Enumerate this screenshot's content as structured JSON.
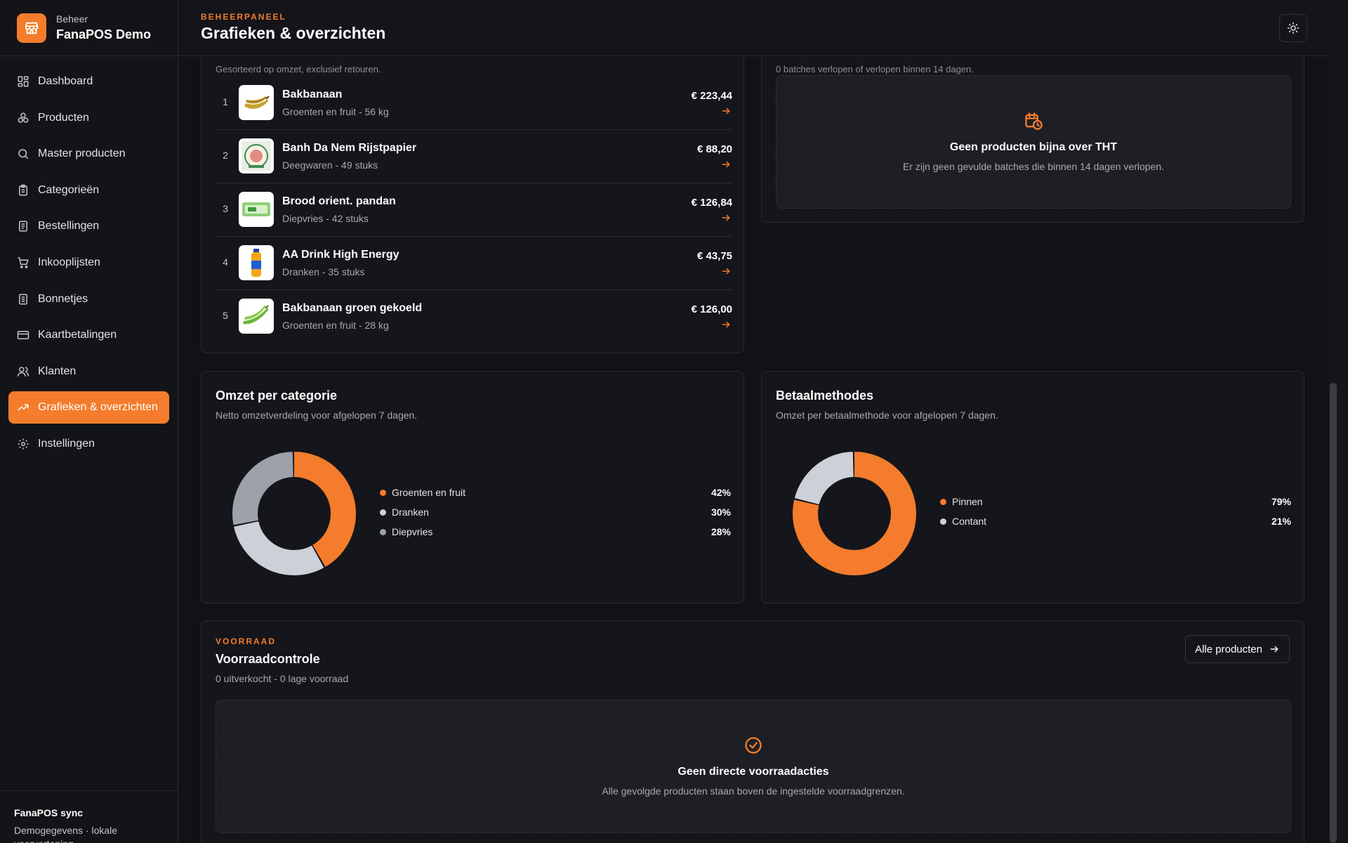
{
  "brand": {
    "subtitle": "Beheer",
    "title": "FanaPOS Demo"
  },
  "nav": [
    {
      "label": "Dashboard",
      "icon": "dashboard-icon"
    },
    {
      "label": "Producten",
      "icon": "boxes-icon"
    },
    {
      "label": "Master producten",
      "icon": "search-icon"
    },
    {
      "label": "Categorieën",
      "icon": "clipboard-icon"
    },
    {
      "label": "Bestellingen",
      "icon": "document-icon"
    },
    {
      "label": "Inkooplijsten",
      "icon": "cart-icon"
    },
    {
      "label": "Bonnetjes",
      "icon": "receipt-icon"
    },
    {
      "label": "Kaartbetalingen",
      "icon": "credit-card-icon"
    },
    {
      "label": "Klanten",
      "icon": "users-icon"
    },
    {
      "label": "Grafieken & overzichten",
      "icon": "trending-up-icon",
      "active": true
    },
    {
      "label": "Instellingen",
      "icon": "gear-icon"
    }
  ],
  "sync": {
    "title": "FanaPOS sync",
    "text": "Demogegevens · lokale voorvertoning"
  },
  "header": {
    "eyebrow": "BEHEERPANEEL",
    "title": "Grafieken & overzichten"
  },
  "top_products": {
    "subtitle": "Gesorteerd op omzet, exclusief retouren.",
    "items": [
      {
        "rank": "1",
        "name": "Bakbanaan",
        "meta": "Groenten en fruit - 56 kg",
        "price": "€ 223,44",
        "image": "plantain"
      },
      {
        "rank": "2",
        "name": "Banh Da Nem Rijstpapier",
        "meta": "Deegwaren - 49 stuks",
        "price": "€ 88,20",
        "image": "rice-paper"
      },
      {
        "rank": "3",
        "name": "Brood orient. pandan",
        "meta": "Diepvries - 42 stuks",
        "price": "€ 126,84",
        "image": "pandan-bread"
      },
      {
        "rank": "4",
        "name": "AA Drink High Energy",
        "meta": "Dranken - 35 stuks",
        "price": "€ 43,75",
        "image": "energy-drink"
      },
      {
        "rank": "5",
        "name": "Bakbanaan groen gekoeld",
        "meta": "Groenten en fruit - 28 kg",
        "price": "€ 126,00",
        "image": "green-plantain"
      }
    ]
  },
  "expiry": {
    "subtitle": "0 batches verlopen of verlopen binnen 14 dagen.",
    "empty_title": "Geen producten bijna over THT",
    "empty_text": "Er zijn geen gevulde batches die binnen 14 dagen verlopen."
  },
  "category_revenue": {
    "title": "Omzet per categorie",
    "subtitle": "Netto omzetverdeling voor afgelopen 7 dagen."
  },
  "payment_methods": {
    "title": "Betaalmethodes",
    "subtitle": "Omzet per betaalmethode voor afgelopen 7 dagen."
  },
  "chart_data": [
    {
      "type": "pie",
      "categories": [
        "Groenten en fruit",
        "Dranken",
        "Diepvries"
      ],
      "values": [
        42,
        30,
        28
      ],
      "labels": [
        "42%",
        "30%",
        "28%"
      ],
      "colors": [
        "#f47c2c",
        "#cdd0d6",
        "#9da1a9"
      ],
      "donut": true,
      "legend": "right"
    },
    {
      "type": "pie",
      "categories": [
        "Pinnen",
        "Contant"
      ],
      "values": [
        79,
        21
      ],
      "labels": [
        "79%",
        "21%"
      ],
      "colors": [
        "#f47c2c",
        "#cdd0d6"
      ],
      "donut": true,
      "legend": "right"
    }
  ],
  "stock": {
    "eyebrow": "VOORRAAD",
    "title": "Voorraadcontrole",
    "subtitle": "0 uitverkocht - 0 lage voorraad",
    "button_label": "Alle producten",
    "empty_title": "Geen directe voorraadacties",
    "empty_text": "Alle gevolgde producten staan boven de ingestelde voorraadgrenzen."
  },
  "colors": {
    "accent": "#f47c2c",
    "background": "#111216",
    "card": "#15161b"
  }
}
